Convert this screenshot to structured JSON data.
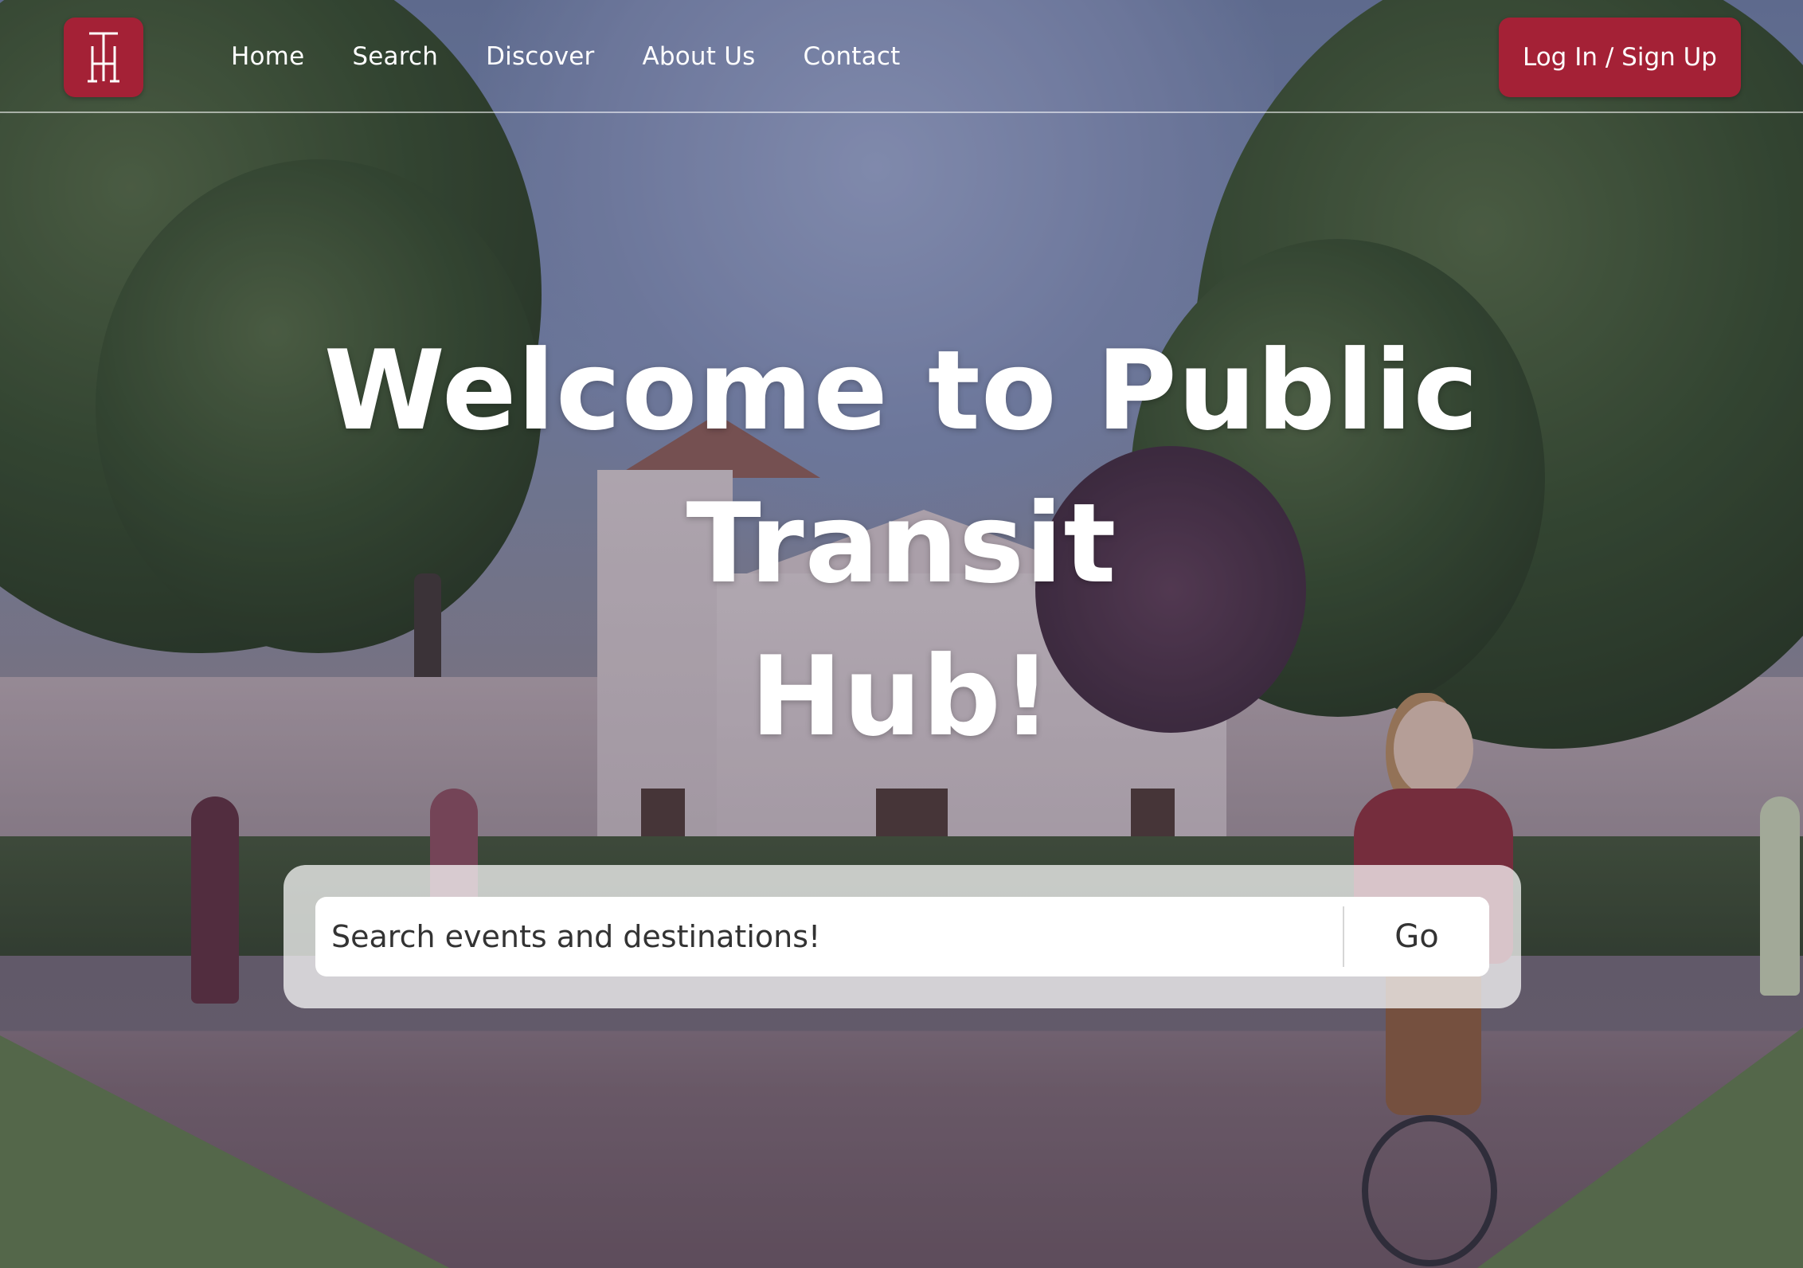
{
  "nav": {
    "logo_alt": "TH logo",
    "items": [
      {
        "label": "Home"
      },
      {
        "label": "Search"
      },
      {
        "label": "Discover"
      },
      {
        "label": "About Us"
      },
      {
        "label": "Contact"
      }
    ],
    "login_label": "Log In / Sign Up"
  },
  "hero": {
    "title_line1": "Welcome to Public Transit",
    "title_line2": "Hub!"
  },
  "search": {
    "placeholder": "Search events and destinations!",
    "value": "",
    "go_label": "Go"
  },
  "colors": {
    "brand": "#a42136",
    "text_light": "#ffffff"
  },
  "icons": {
    "logo": "th-monogram-icon",
    "background": "campus-mission-photo"
  }
}
